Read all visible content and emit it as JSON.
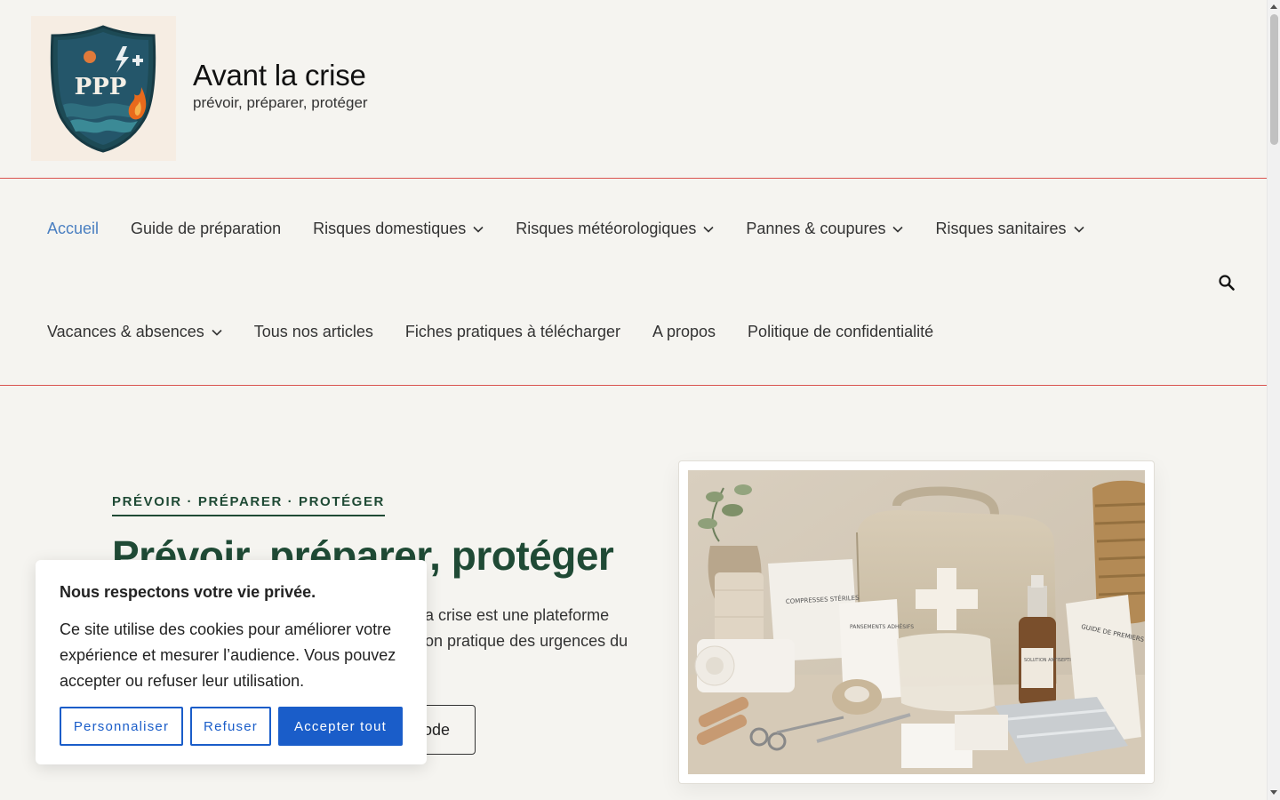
{
  "header": {
    "title": "Avant la crise",
    "tagline": "prévoir, préparer, protéger",
    "logo_text": "PPP"
  },
  "nav": {
    "row1": [
      {
        "label": "Accueil",
        "active": true,
        "dropdown": false
      },
      {
        "label": "Guide de préparation",
        "active": false,
        "dropdown": false
      },
      {
        "label": "Risques domestiques",
        "active": false,
        "dropdown": true
      },
      {
        "label": "Risques météorologiques",
        "active": false,
        "dropdown": true
      },
      {
        "label": "Pannes & coupures",
        "active": false,
        "dropdown": true
      },
      {
        "label": "Risques sanitaires",
        "active": false,
        "dropdown": true
      }
    ],
    "row2": [
      {
        "label": "Vacances & absences",
        "active": false,
        "dropdown": true
      },
      {
        "label": "Tous nos articles",
        "active": false,
        "dropdown": false
      },
      {
        "label": "Fiches pratiques à télécharger",
        "active": false,
        "dropdown": false
      },
      {
        "label": "A propos",
        "active": false,
        "dropdown": false
      },
      {
        "label": "Politique de confidentialité",
        "active": false,
        "dropdown": false
      }
    ],
    "search_icon": "search-icon"
  },
  "hero": {
    "kicker": "PRÉVOIR · PRÉPARER · PROTÉGER",
    "title": "Prévoir, préparer, protéger",
    "text_visible_line1": "a crise est une plateforme",
    "text_visible_line2": "on pratique des urgences du",
    "cta_visible": "ode",
    "image_labels": {
      "compresses": "COMPRESSES STÉRILES",
      "pansements": "PANSEMENTS ADHÉSIFS",
      "guide": "GUIDE DE PREMIERS SECOURS",
      "solution": "SOLUTION ANTISEPTIQUE"
    }
  },
  "cookie": {
    "title": "Nous respectons votre vie privée.",
    "text": "Ce site utilise des cookies pour améliorer votre expérience et mesurer l’audience. Vous pouvez accepter ou refuser leur utilisation.",
    "customize_label": "Personnaliser",
    "refuse_label": "Refuser",
    "accept_label": "Accepter tout"
  },
  "colors": {
    "accent_red": "#d9534f",
    "brand_green": "#1f4a35",
    "link_blue": "#4a7fc1",
    "button_blue": "#1a5dc9",
    "background": "#f5f4f0"
  }
}
